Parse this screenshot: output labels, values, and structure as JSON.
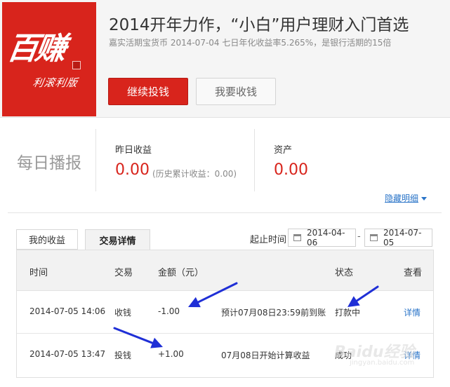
{
  "banner": {
    "logo_text_big": "百赚",
    "logo_text_small": "利滚利版",
    "title": "2014开年力作，“小白”用户理财入门首选",
    "subtitle": "嘉实活期宝货币 2014-07-04 七日年化收益率5.265%，是银行活期的15倍",
    "continue_invest_label": "继续投钱",
    "withdraw_label": "我要收钱"
  },
  "daily": {
    "title": "每日播报",
    "yesterday_label": "昨日收益",
    "yesterday_value": "0.00",
    "history_note": "(历史累计收益：0.00)",
    "assets_label": "资产",
    "assets_value": "0.00",
    "hide_detail_label": "隐藏明细"
  },
  "tabs": [
    {
      "label": "我的收益",
      "active": false
    },
    {
      "label": "交易详情",
      "active": true
    }
  ],
  "date_range": {
    "label": "起止时间",
    "start": "2014-04-06",
    "separator": "-",
    "end": "2014-07-05"
  },
  "table": {
    "headers": [
      "时间",
      "交易",
      "金额（元）",
      "状态",
      "查看"
    ],
    "rows": [
      {
        "time": "2014-07-05 14:06",
        "type": "收钱",
        "amount": "-1.00",
        "note": "预计07月08日23:59前到账",
        "status": "打款中",
        "view": "详情"
      },
      {
        "time": "2014-07-05 13:47",
        "type": "投钱",
        "amount": "+1.00",
        "note": "07月08日开始计算收益",
        "status": "成功",
        "view": "详情"
      }
    ]
  },
  "colors": {
    "brand_red": "#d8241c",
    "link_blue": "#2a74c8",
    "annotation_arrow": "#1f2fd6"
  },
  "watermark": {
    "main": "Baidu经验",
    "sub": "jingyan.baidu.com"
  }
}
